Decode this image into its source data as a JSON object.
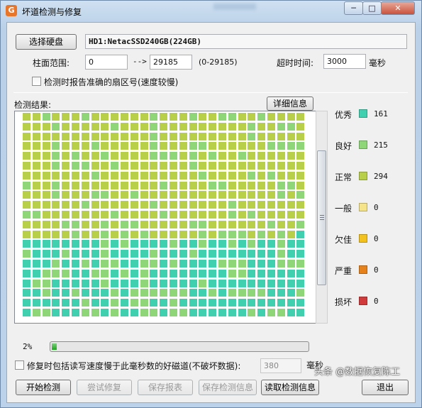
{
  "window": {
    "title": "坏道检测与修复",
    "icon_letter": "G",
    "title_obscured": ""
  },
  "caption": {
    "minimize": "─",
    "maximize": "□",
    "close": "✕"
  },
  "disk": {
    "select_button": "选择硬盘",
    "name": "HD1:NetacSSD240GB(224GB)"
  },
  "range": {
    "label": "柱面范围:",
    "start": "0",
    "arrow": "-->",
    "end": "29185",
    "hint": "(0-29185)"
  },
  "timeout": {
    "label": "超时时间:",
    "value": "3000",
    "unit": "毫秒"
  },
  "report_sector": {
    "label": "检测时报告准确的扇区号(速度较慢)",
    "checked": false
  },
  "results": {
    "label": "检测结果:",
    "detail_button": "详细信息"
  },
  "legend": [
    {
      "label": "优秀",
      "color": "#40d0b0",
      "count": "161"
    },
    {
      "label": "良好",
      "color": "#8ed678",
      "count": "215"
    },
    {
      "label": "正常",
      "color": "#b8cf4a",
      "count": "294"
    },
    {
      "label": "一般",
      "color": "#f5e48a",
      "count": "0"
    },
    {
      "label": "欠佳",
      "color": "#f3c21e",
      "count": "0"
    },
    {
      "label": "严重",
      "color": "#e6821c",
      "count": "0"
    },
    {
      "label": "损坏",
      "color": "#d03a3a",
      "count": "0"
    }
  ],
  "progress": {
    "text": "2%",
    "value": 0.02
  },
  "repair_option": {
    "label": "修复时包括读写速度慢于此毫秒数的好磁道(不破坏数据):",
    "value": "380",
    "unit": "毫秒",
    "checked": false
  },
  "buttons": {
    "start": "开始检测",
    "try_repair": "尝试修复",
    "save_report": "保存报表",
    "save_result": "保存检测信息",
    "load_result": "读取检测信息",
    "exit": "退出"
  },
  "watermark": "头条 @数据恢复陈工",
  "chart_data": {
    "type": "heatmap",
    "title": "",
    "columns": 29,
    "rows": 21,
    "categories": [
      "优秀",
      "良好",
      "正常",
      "一般",
      "欠佳",
      "严重",
      "损坏"
    ],
    "values": [
      161,
      215,
      294,
      0,
      0,
      0,
      0
    ]
  }
}
